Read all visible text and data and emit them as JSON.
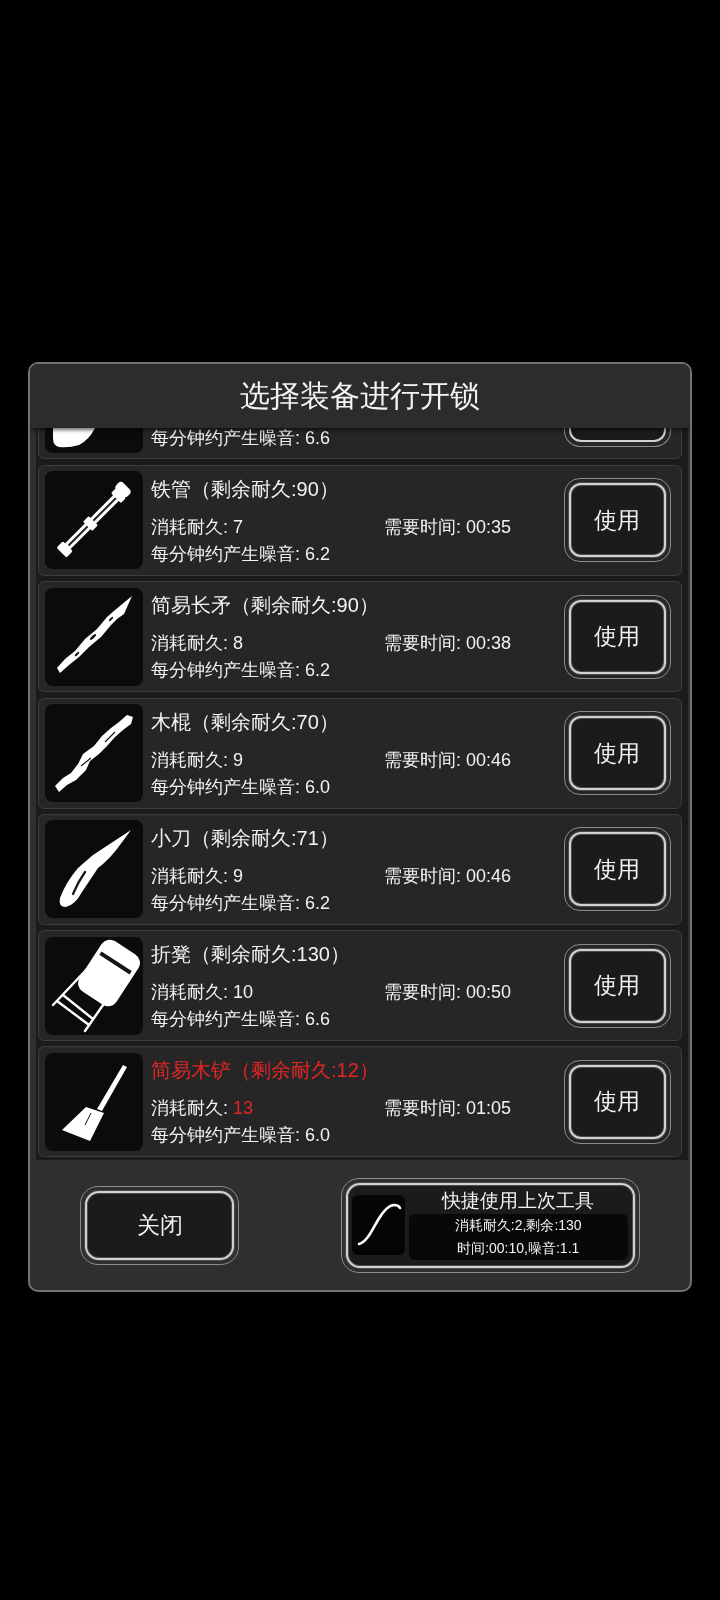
{
  "dialog": {
    "title": "选择装备进行开锁"
  },
  "items": [
    {
      "kind": "partial",
      "noise": "每分钟约产生噪音: 6.6"
    },
    {
      "kind": "full",
      "name": "铁管（剩余耐久:90）",
      "low_durability": false,
      "cost_label": "消耗耐久:",
      "cost": "7",
      "cost_high": false,
      "time": "需要时间: 00:35",
      "noise": "每分钟约产生噪音: 6.2",
      "button": "使用"
    },
    {
      "kind": "full",
      "name": "简易长矛（剩余耐久:90）",
      "low_durability": false,
      "cost_label": "消耗耐久:",
      "cost": "8",
      "cost_high": false,
      "time": "需要时间: 00:38",
      "noise": "每分钟约产生噪音: 6.2",
      "button": "使用"
    },
    {
      "kind": "full",
      "name": "木棍（剩余耐久:70）",
      "low_durability": false,
      "cost_label": "消耗耐久:",
      "cost": "9",
      "cost_high": false,
      "time": "需要时间: 00:46",
      "noise": "每分钟约产生噪音: 6.0",
      "button": "使用"
    },
    {
      "kind": "full",
      "name": "小刀（剩余耐久:71）",
      "low_durability": false,
      "cost_label": "消耗耐久:",
      "cost": "9",
      "cost_high": false,
      "time": "需要时间: 00:46",
      "noise": "每分钟约产生噪音: 6.2",
      "button": "使用"
    },
    {
      "kind": "full",
      "name": "折凳（剩余耐久:130）",
      "low_durability": false,
      "cost_label": "消耗耐久:",
      "cost": "10",
      "cost_high": false,
      "time": "需要时间: 00:50",
      "noise": "每分钟约产生噪音: 6.6",
      "button": "使用"
    },
    {
      "kind": "full",
      "name": "简易木铲（剩余耐久:12）",
      "low_durability": true,
      "cost_label": "消耗耐久:",
      "cost": "13",
      "cost_high": true,
      "time": "需要时间: 01:05",
      "noise": "每分钟约产生噪音: 6.0",
      "button": "使用"
    }
  ],
  "footer": {
    "close_button": "关闭",
    "quick_use": {
      "title": "快捷使用上次工具",
      "lines": [
        "消耗耐久:2,剩余:130",
        "时间:00:10,噪音:1.1"
      ]
    }
  }
}
